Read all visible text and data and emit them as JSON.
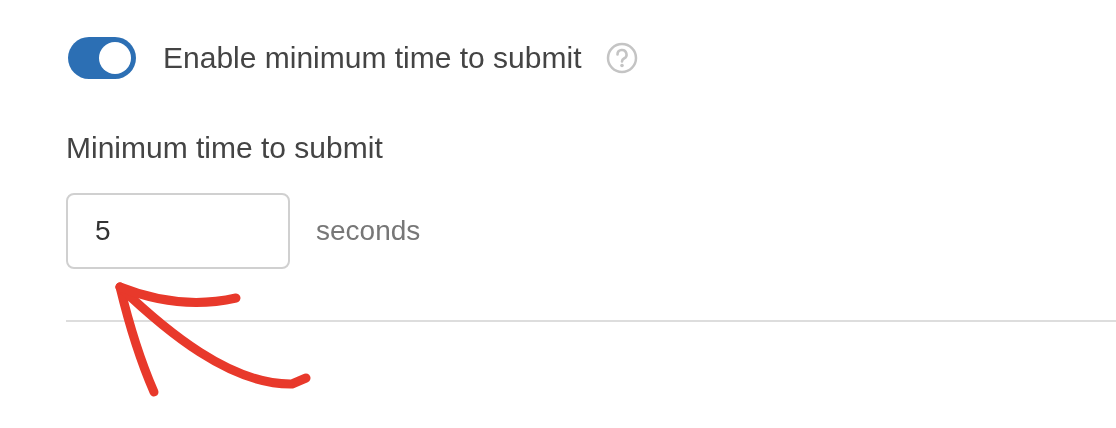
{
  "toggle": {
    "label": "Enable minimum time to submit",
    "on": true
  },
  "field": {
    "label": "Minimum time to submit",
    "value": "5",
    "unit": "seconds"
  }
}
